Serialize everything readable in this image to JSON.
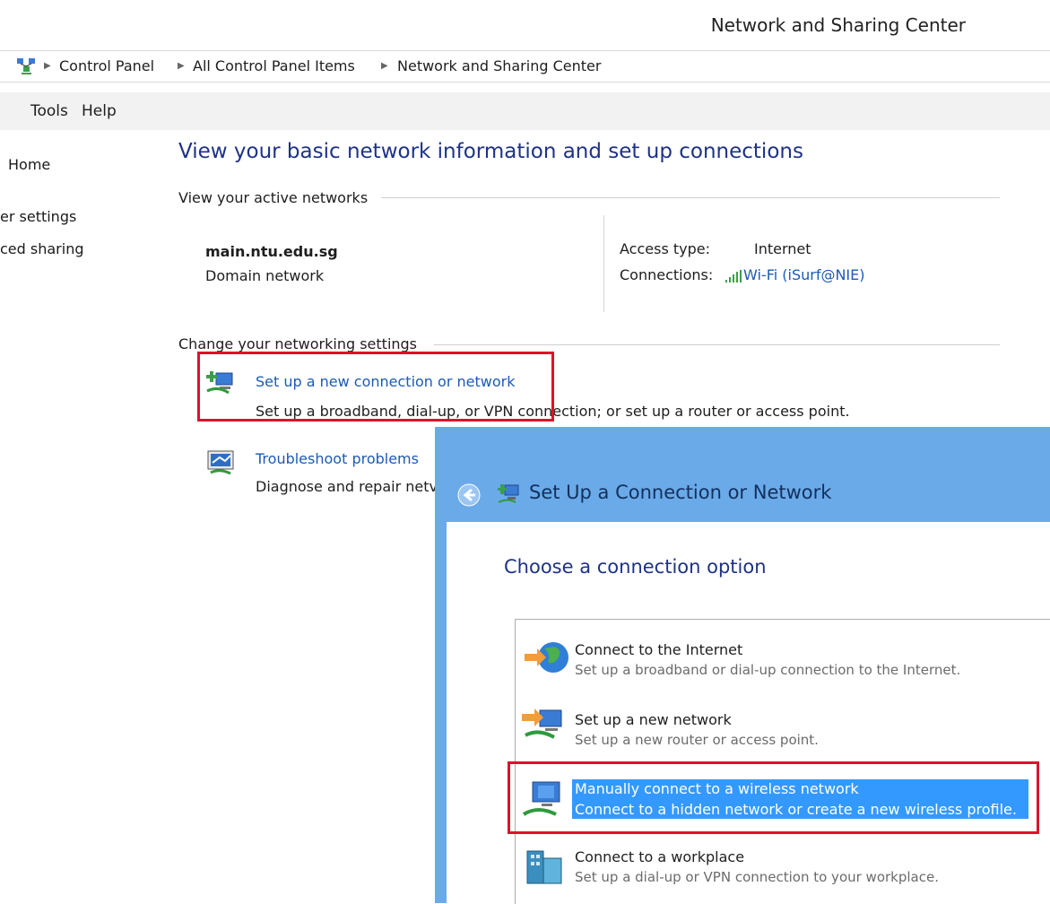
{
  "window": {
    "title": "Network and Sharing Center"
  },
  "breadcrumb": [
    "Control Panel",
    "All Control Panel Items",
    "Network and Sharing Center"
  ],
  "menu": [
    "Tools",
    "Help"
  ],
  "left_nav": [
    "Home",
    "er settings",
    "ced sharing"
  ],
  "main": {
    "heading": "View your basic network information and set up connections",
    "active_networks_label": "View your active networks",
    "network_name": "main.ntu.edu.sg",
    "network_type": "Domain network",
    "access_type_label": "Access type:",
    "access_type_value": "Internet",
    "connections_label": "Connections:",
    "connections_value": "Wi-Fi (iSurf@NIE)",
    "change_settings_label": "Change your networking settings",
    "tasks": [
      {
        "title": "Set up a new connection or network",
        "desc": "Set up a broadband, dial-up, or VPN connection; or set up a router or access point."
      },
      {
        "title": "Troubleshoot problems",
        "desc": "Diagnose and repair netv"
      }
    ]
  },
  "dialog": {
    "title": "Set Up a Connection or Network",
    "heading": "Choose a connection option",
    "options": [
      {
        "title": "Connect to the Internet",
        "desc": "Set up a broadband or dial-up connection to the Internet.",
        "icon": "globe-icon"
      },
      {
        "title": "Set up a new network",
        "desc": "Set up a new router or access point.",
        "icon": "new-network-icon"
      },
      {
        "title": "Manually connect to a wireless network",
        "desc": "Connect to a hidden network or create a new wireless profile.",
        "icon": "wireless-network-icon",
        "selected": true
      },
      {
        "title": "Connect to a workplace",
        "desc": "Set up a dial-up or VPN connection to your workplace.",
        "icon": "workplace-icon"
      }
    ]
  },
  "colors": {
    "accent_blue": "#1e3287",
    "link_blue": "#1c5ab5",
    "highlight_red": "#e0102c",
    "selection_blue": "#3399ff",
    "dialog_frame": "#6aaae9"
  }
}
